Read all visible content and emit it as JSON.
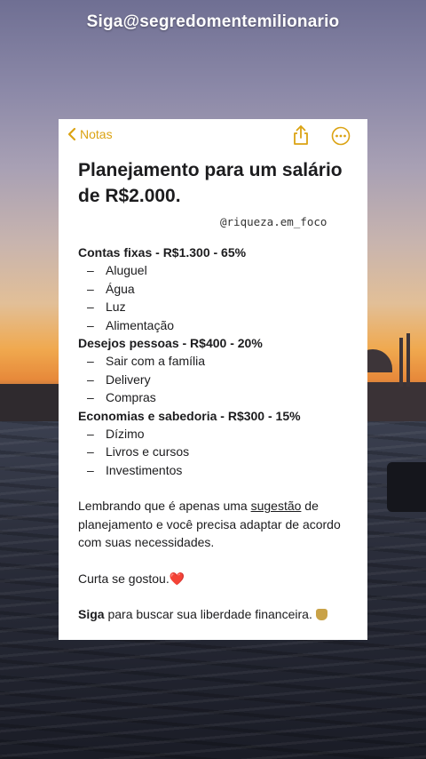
{
  "watermark": "Siga@segredomentemilionario",
  "note": {
    "back_label": "Notas",
    "title": "Planejamento para um salário de R$2.000.",
    "handle": "@riqueza.em_foco",
    "sections": [
      {
        "heading": "Contas fixas - R$1.300 - 65%",
        "items": [
          "Aluguel",
          "Água",
          "Luz",
          "Alimentação"
        ]
      },
      {
        "heading": "Desejos pessoas - R$400 - 20%",
        "items": [
          "Sair com a família",
          "Delivery",
          "Compras"
        ]
      },
      {
        "heading": "Economias e sabedoria - R$300 - 15%",
        "items": [
          "Dízimo",
          "Livros e cursos",
          "Investimentos"
        ]
      }
    ],
    "para1_before": "Lembrando que é apenas uma ",
    "para1_link": "sugestão",
    "para1_after": " de planejamento e você precisa adaptar de acordo com suas necessidades.",
    "para2": "Curta se gostou.",
    "para2_emoji": "❤️",
    "para3_bold": "Siga",
    "para3_rest": " para buscar sua liberdade financeira.",
    "para3_emoji": "money-bag-icon"
  },
  "colors": {
    "accent": "#dba313"
  }
}
